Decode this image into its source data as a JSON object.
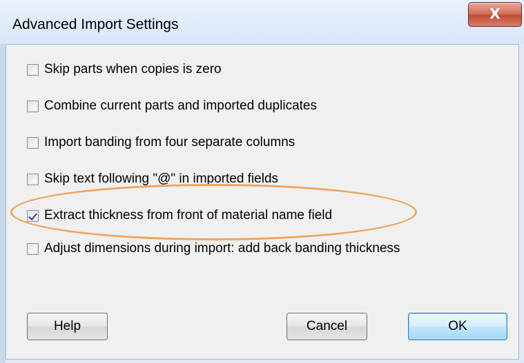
{
  "window": {
    "title": "Advanced Import Settings",
    "close_glyph": "X"
  },
  "options": [
    {
      "label": "Skip parts when copies is zero",
      "checked": false
    },
    {
      "label": "Combine current parts and imported duplicates",
      "checked": false
    },
    {
      "label": "Import banding from four separate columns",
      "checked": false
    },
    {
      "label": "Skip text following \"@\" in imported fields",
      "checked": false
    },
    {
      "label": "Extract thickness from front of material name field",
      "checked": true
    },
    {
      "label": "Adjust dimensions during import: add back banding thickness",
      "checked": false
    }
  ],
  "buttons": {
    "help": "Help",
    "cancel": "Cancel",
    "ok": "OK"
  },
  "colors": {
    "highlight_ellipse": "#f0a35a",
    "close_button": "#c9513b",
    "default_button_border": "#3c7fb1"
  }
}
